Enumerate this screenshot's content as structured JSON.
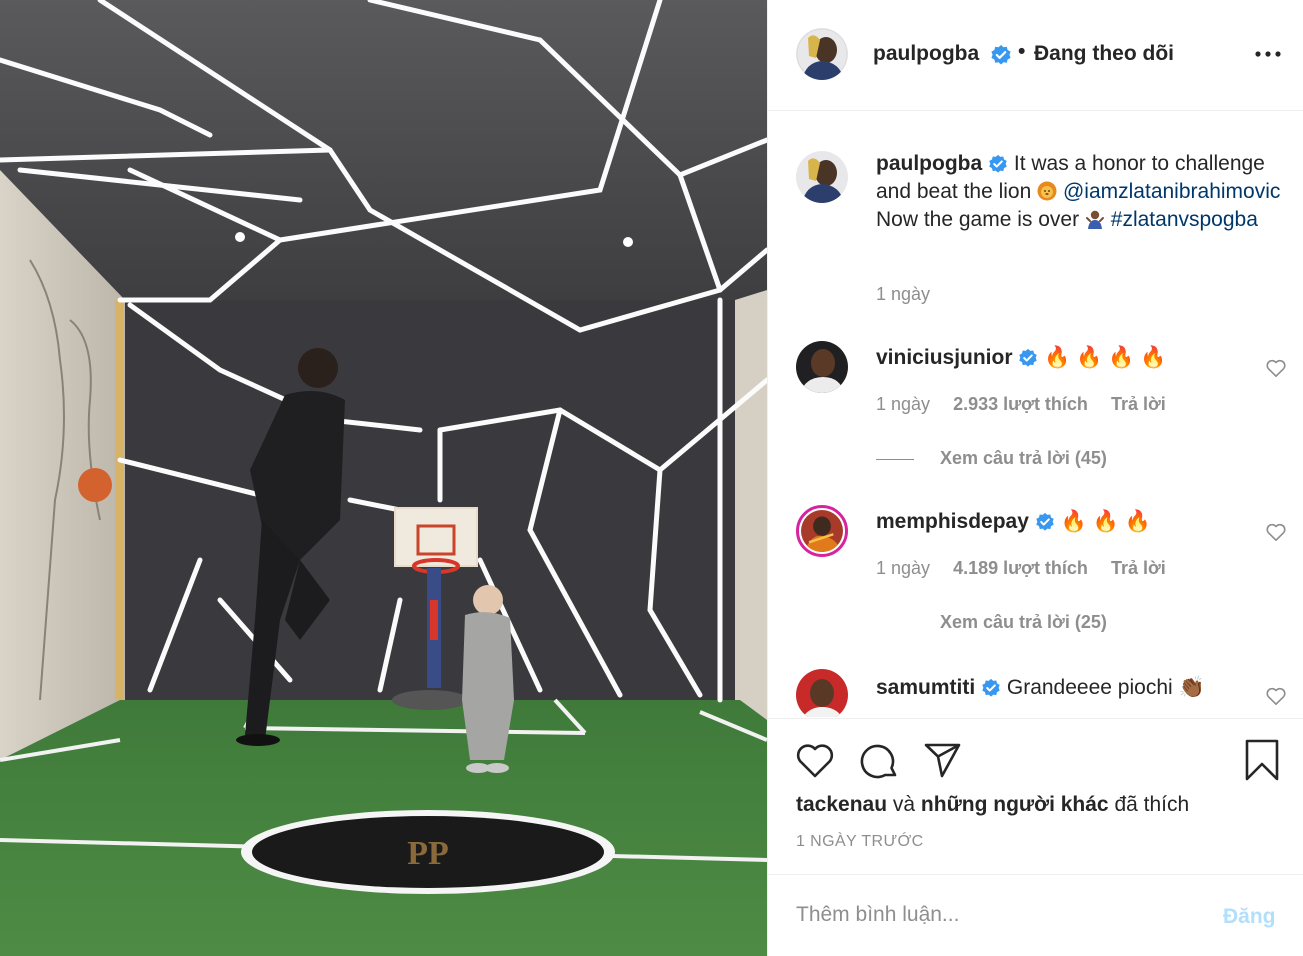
{
  "post": {
    "username": "paulpogba",
    "separator": "•",
    "follow_status": "Đang theo dõi",
    "caption": {
      "part1": "It was a honor to challenge and beat the lion",
      "mention": "@iamzlatanibrahimovic",
      "part2": "Now the game is over",
      "hashtag": "#zlatanvspogba"
    },
    "caption_time": "1 ngày"
  },
  "comments": [
    {
      "username": "viniciusjunior",
      "text": "🔥 🔥 🔥 🔥",
      "time": "1 ngày",
      "likes": "2.933 lượt thích",
      "reply": "Trả lời",
      "view_replies": "Xem câu trả lời (45)"
    },
    {
      "username": "memphisdepay",
      "text": "🔥 🔥 🔥",
      "time": "1 ngày",
      "likes": "4.189 lượt thích",
      "reply": "Trả lời",
      "view_replies": "Xem câu trả lời (25)"
    },
    {
      "username": "samumtiti",
      "text": "Grandeeee piochi 👏🏾"
    }
  ],
  "footer": {
    "liked_by_user": "tackenau",
    "liked_by_rest": "và",
    "liked_by_others": "những người khác",
    "liked_suffix": "đã thích",
    "time_ago": "1 NGÀY TRƯỚC",
    "comment_placeholder": "Thêm bình luận...",
    "post_button": "Đăng"
  },
  "colors": {
    "verified": "#3897f0",
    "link": "#00376b",
    "muted": "#8e8e8e",
    "post_disabled": "#b2dffc"
  },
  "icons": [
    "verified-badge-icon",
    "more-options-icon",
    "heart-icon",
    "comment-icon",
    "share-icon",
    "bookmark-icon"
  ]
}
